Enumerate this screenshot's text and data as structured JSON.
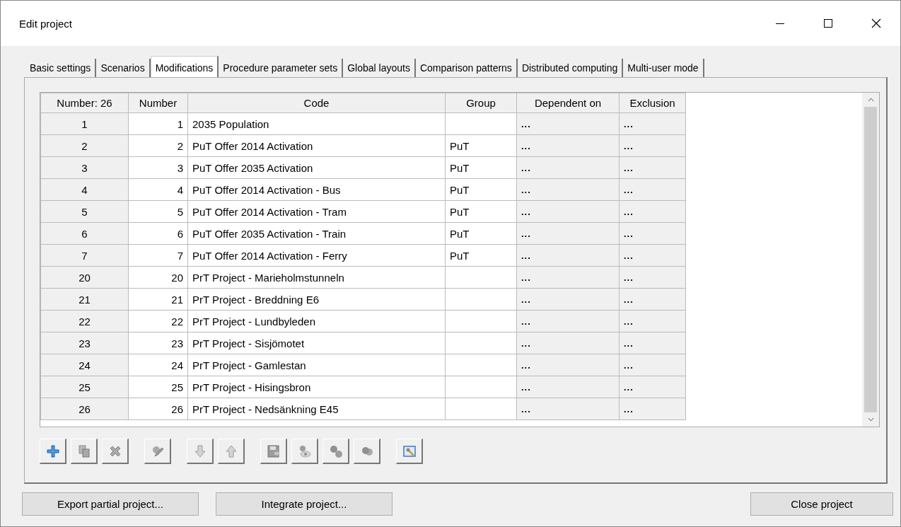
{
  "window": {
    "title": "Edit project"
  },
  "tabs": [
    {
      "label": "Basic settings",
      "selected": false
    },
    {
      "label": "Scenarios",
      "selected": false
    },
    {
      "label": "Modifications",
      "selected": true
    },
    {
      "label": "Procedure parameter sets",
      "selected": false
    },
    {
      "label": "Global layouts",
      "selected": false
    },
    {
      "label": "Comparison patterns",
      "selected": false
    },
    {
      "label": "Distributed computing",
      "selected": false
    },
    {
      "label": "Multi-user mode",
      "selected": false
    }
  ],
  "table": {
    "columns": [
      "Number: 26",
      "Number",
      "Code",
      "Group",
      "Dependent on",
      "Exclusion"
    ],
    "rows": [
      {
        "index": "1",
        "number": "1",
        "code": "2035 Population",
        "group": "",
        "dependent_on": "...",
        "exclusion": "..."
      },
      {
        "index": "2",
        "number": "2",
        "code": "PuT Offer 2014 Activation",
        "group": "PuT",
        "dependent_on": "...",
        "exclusion": "..."
      },
      {
        "index": "3",
        "number": "3",
        "code": "PuT Offer 2035 Activation",
        "group": "PuT",
        "dependent_on": "...",
        "exclusion": "..."
      },
      {
        "index": "4",
        "number": "4",
        "code": "PuT Offer 2014 Activation - Bus",
        "group": "PuT",
        "dependent_on": "...",
        "exclusion": "..."
      },
      {
        "index": "5",
        "number": "5",
        "code": "PuT Offer 2014 Activation - Tram",
        "group": "PuT",
        "dependent_on": "...",
        "exclusion": "..."
      },
      {
        "index": "6",
        "number": "6",
        "code": "PuT Offer 2035 Activation - Train",
        "group": "PuT",
        "dependent_on": "...",
        "exclusion": "..."
      },
      {
        "index": "7",
        "number": "7",
        "code": "PuT Offer 2014 Activation - Ferry",
        "group": "PuT",
        "dependent_on": "...",
        "exclusion": "..."
      },
      {
        "index": "20",
        "number": "20",
        "code": "PrT Project - Marieholmstunneln",
        "group": "",
        "dependent_on": "...",
        "exclusion": "..."
      },
      {
        "index": "21",
        "number": "21",
        "code": "PrT Project - Breddning E6",
        "group": "",
        "dependent_on": "...",
        "exclusion": "..."
      },
      {
        "index": "22",
        "number": "22",
        "code": "PrT Project - Lundbyleden",
        "group": "",
        "dependent_on": "...",
        "exclusion": "..."
      },
      {
        "index": "23",
        "number": "23",
        "code": "PrT Project - Sisjömotet",
        "group": "",
        "dependent_on": "...",
        "exclusion": "..."
      },
      {
        "index": "24",
        "number": "24",
        "code": "PrT Project - Gamlestan",
        "group": "",
        "dependent_on": "...",
        "exclusion": "..."
      },
      {
        "index": "25",
        "number": "25",
        "code": "PrT Project - Hisingsbron",
        "group": "",
        "dependent_on": "...",
        "exclusion": "..."
      },
      {
        "index": "26",
        "number": "26",
        "code": "PrT Project - Nedsänkning E45",
        "group": "",
        "dependent_on": "...",
        "exclusion": "..."
      }
    ]
  },
  "toolbar": [
    {
      "kind": "add",
      "disabled": false
    },
    {
      "kind": "copy",
      "disabled": true
    },
    {
      "kind": "delete",
      "disabled": true
    },
    {
      "kind": "edit",
      "disabled": true
    },
    {
      "kind": "down",
      "disabled": true
    },
    {
      "kind": "up",
      "disabled": true
    },
    {
      "kind": "save",
      "disabled": true
    },
    {
      "kind": "view",
      "disabled": true
    },
    {
      "kind": "group",
      "disabled": true
    },
    {
      "kind": "merge",
      "disabled": true
    },
    {
      "kind": "settings",
      "disabled": false
    }
  ],
  "buttons": {
    "left": [
      "Export partial project...",
      "Integrate project..."
    ],
    "right": [
      "Close project"
    ]
  }
}
